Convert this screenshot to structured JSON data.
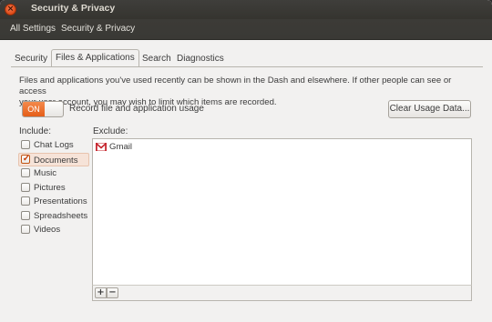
{
  "window": {
    "title": "Security & Privacy",
    "close_glyph": "×"
  },
  "toolbar": {
    "all_settings": "All Settings",
    "current": "Security & Privacy"
  },
  "tabs": [
    {
      "label": "Security",
      "active": false
    },
    {
      "label": "Files & Applications",
      "active": true
    },
    {
      "label": "Search",
      "active": false
    },
    {
      "label": "Diagnostics",
      "active": false
    }
  ],
  "files_apps": {
    "description_line1": "Files and applications you've used recently can be shown in the Dash and elsewhere. If other people can see or access",
    "description_line2": "your user account, you may wish to limit which items are recorded.",
    "toggle_state": "ON",
    "toggle_label": "Record file and application usage",
    "clear_button": "Clear Usage Data...",
    "include_label": "Include:",
    "exclude_label": "Exclude:",
    "include_items": [
      {
        "label": "Chat Logs",
        "checked": false
      },
      {
        "label": "Documents",
        "checked": true
      },
      {
        "label": "Music",
        "checked": false
      },
      {
        "label": "Pictures",
        "checked": false
      },
      {
        "label": "Presentations",
        "checked": false
      },
      {
        "label": "Spreadsheets",
        "checked": false
      },
      {
        "label": "Videos",
        "checked": false
      }
    ],
    "exclude_items": [
      {
        "label": "Gmail",
        "icon": "gmail-icon"
      }
    ],
    "add_glyph": "+",
    "remove_glyph": "−",
    "check_glyph": "✓"
  },
  "colors": {
    "accent": "#e55e18",
    "titlebar": "#3c3b37",
    "background": "#f2f1f0"
  }
}
